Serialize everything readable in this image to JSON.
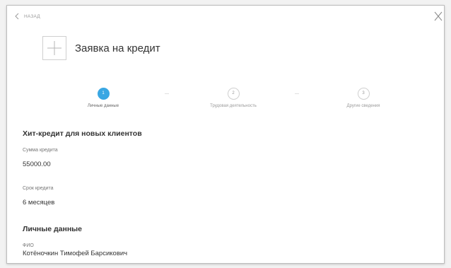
{
  "nav": {
    "back_label": "НАЗАД"
  },
  "header": {
    "title": "Заявка на кредит"
  },
  "steps": [
    {
      "number": "1",
      "label": "Личные данные",
      "state": "active"
    },
    {
      "number": "2",
      "label": "Трудовая деятельность",
      "state": "idle"
    },
    {
      "number": "3",
      "label": "Другие сведения",
      "state": "idle"
    }
  ],
  "offer": {
    "title": "Хит-кредит для новых клиентов",
    "amount_label": "Сумма кредита",
    "amount_value": "55000.00",
    "term_label": "Срок кредита",
    "term_value": "6 месяцев"
  },
  "personal": {
    "title": "Личные данные",
    "name_label": "ФИО",
    "name_value": "Котёночкин Тимофей Барсикович"
  },
  "colors": {
    "accent": "#3aa7e3",
    "background": "#f2f2f2",
    "card": "#ffffff"
  },
  "icons": {
    "back": "chevron-left-icon",
    "close": "close-icon",
    "logo": "plus-icon"
  }
}
